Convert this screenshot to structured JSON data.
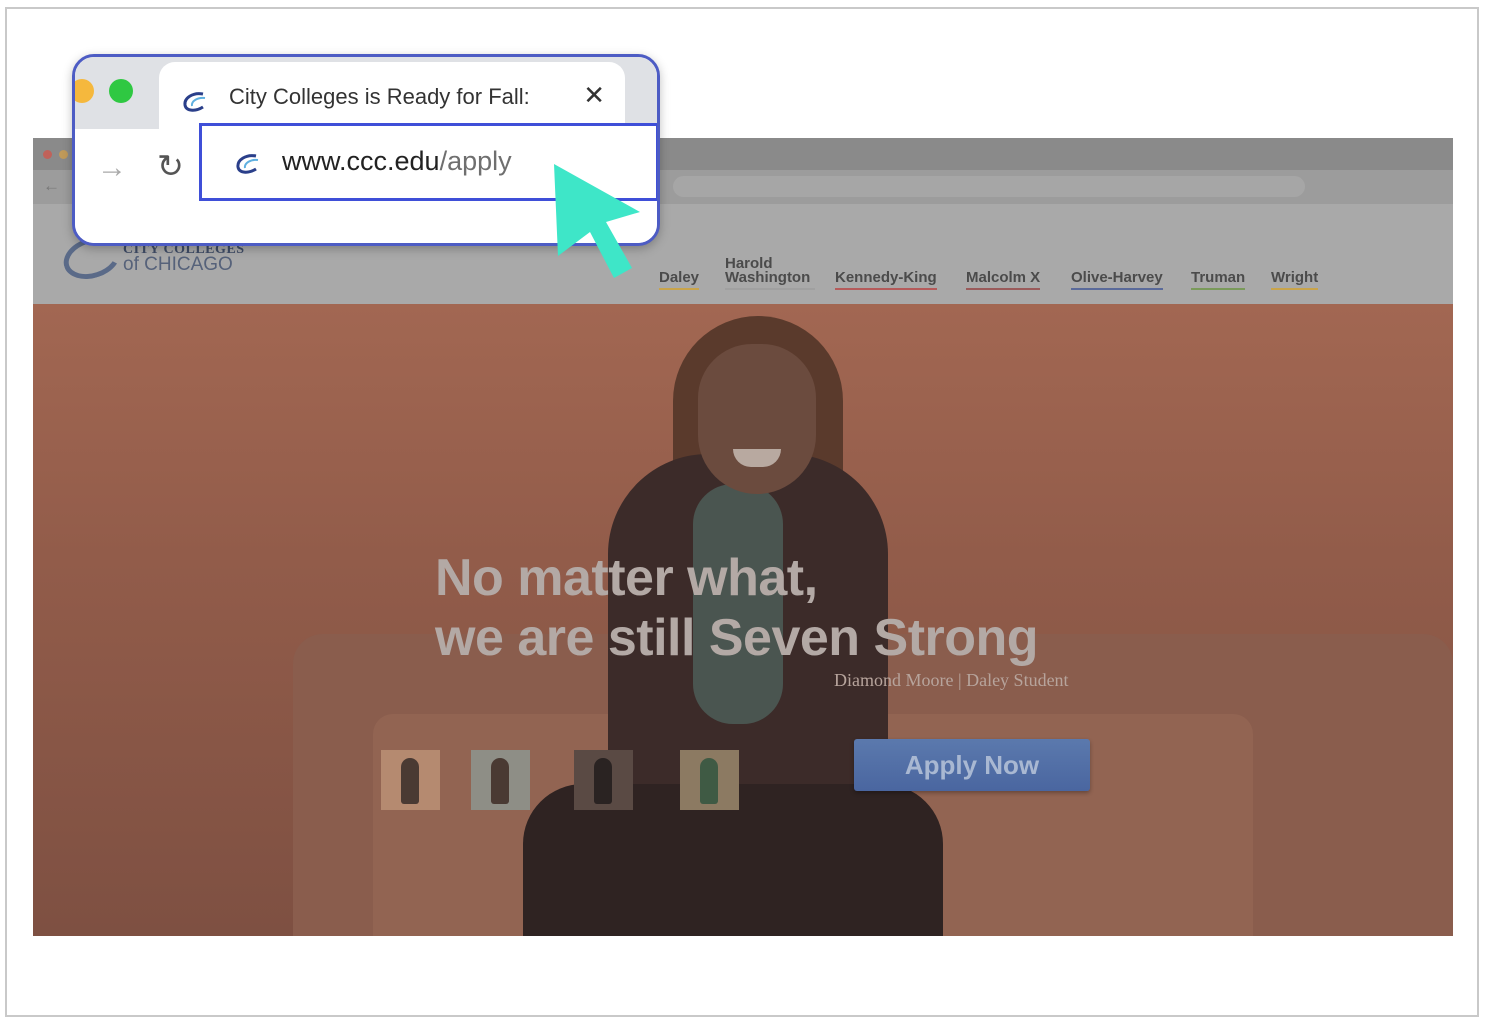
{
  "callout": {
    "tab_title": "City Colleges is Ready for Fall:",
    "tab_close": "✕",
    "forward_glyph": "→",
    "reload_glyph": "↻",
    "url_host": "www.ccc.edu",
    "url_path": "/apply"
  },
  "site": {
    "logo_top": "CITY COLLEGES",
    "logo_bottom": "of CHICAGO",
    "nav": [
      {
        "label": "Daley",
        "underline": "#c9a44a"
      },
      {
        "label": "Harold Washington",
        "underline": "#a0a0a0"
      },
      {
        "label": "Kennedy-King",
        "underline": "#b55a5a"
      },
      {
        "label": "Malcolm X",
        "underline": "#9a5a5a"
      },
      {
        "label": "Olive-Harvey",
        "underline": "#5a6a9a"
      },
      {
        "label": "Truman",
        "underline": "#7a9a5a"
      },
      {
        "label": "Wright",
        "underline": "#c9a44a"
      }
    ],
    "hero": {
      "headline_line1": "No matter what,",
      "headline_line2": "we are still Seven Strong",
      "caption": "Diamond Moore | Daley Student",
      "apply_label": "Apply Now"
    },
    "back_glyph": "←"
  },
  "colors": {
    "callout_border": "#4d5cc4",
    "address_border": "#3f4fd8",
    "cursor": "#3ee6c8"
  },
  "icons": [
    "ccc-favicon",
    "forward-arrow-icon",
    "reload-icon",
    "close-icon",
    "cursor-arrow-icon"
  ]
}
